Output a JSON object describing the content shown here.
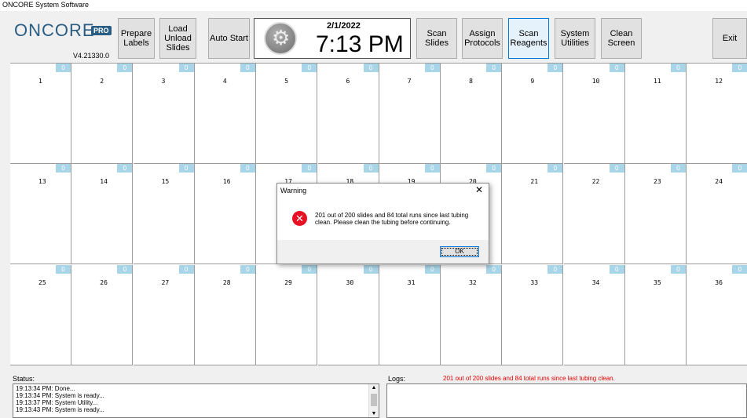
{
  "window": {
    "title": "ONCORE System Software"
  },
  "logo": {
    "word": "ONCORE",
    "badge": "PRO",
    "version": "V4.21330.0"
  },
  "toolbar": {
    "prepare_labels": "Prepare\nLabels",
    "load_unload": "Load\nUnload\nSlides",
    "auto_start": "Auto Start",
    "scan_slides": "Scan\nSlides",
    "assign_protocols": "Assign\nProtocols",
    "scan_reagents": "Scan\nReagents",
    "system_utilities": "System\nUtilities",
    "clean_screen": "Clean\nScreen",
    "exit": "Exit"
  },
  "clock": {
    "date": "2/1/2022",
    "time": "7:13 PM"
  },
  "slots": [
    {
      "num": "1",
      "count": "0"
    },
    {
      "num": "2",
      "count": "0"
    },
    {
      "num": "3",
      "count": "0"
    },
    {
      "num": "4",
      "count": "0"
    },
    {
      "num": "5",
      "count": "0"
    },
    {
      "num": "6",
      "count": "0"
    },
    {
      "num": "7",
      "count": "0"
    },
    {
      "num": "8",
      "count": "0"
    },
    {
      "num": "9",
      "count": "0"
    },
    {
      "num": "10",
      "count": "0"
    },
    {
      "num": "11",
      "count": "0"
    },
    {
      "num": "12",
      "count": "0"
    },
    {
      "num": "13",
      "count": "0"
    },
    {
      "num": "14",
      "count": "0"
    },
    {
      "num": "15",
      "count": "0"
    },
    {
      "num": "16",
      "count": "0"
    },
    {
      "num": "17",
      "count": "0"
    },
    {
      "num": "18",
      "count": "0"
    },
    {
      "num": "19",
      "count": "0"
    },
    {
      "num": "20",
      "count": "0"
    },
    {
      "num": "21",
      "count": "0"
    },
    {
      "num": "22",
      "count": "0"
    },
    {
      "num": "23",
      "count": "0"
    },
    {
      "num": "24",
      "count": "0"
    },
    {
      "num": "25",
      "count": "0"
    },
    {
      "num": "26",
      "count": "0"
    },
    {
      "num": "27",
      "count": "0"
    },
    {
      "num": "28",
      "count": "0"
    },
    {
      "num": "29",
      "count": "0"
    },
    {
      "num": "30",
      "count": "0"
    },
    {
      "num": "31",
      "count": "0"
    },
    {
      "num": "32",
      "count": "0"
    },
    {
      "num": "33",
      "count": "0"
    },
    {
      "num": "34",
      "count": "0"
    },
    {
      "num": "35",
      "count": "0"
    },
    {
      "num": "36",
      "count": "0"
    }
  ],
  "status": {
    "label": "Status:",
    "lines": [
      "19:13:34 PM: Done...",
      "19:13:34 PM: System is ready...",
      "19:13:37 PM: System Utility...",
      "19:13:43 PM: System is ready..."
    ]
  },
  "logs": {
    "label": "Logs:",
    "message": "201 out of 200 slides and  84  total runs since last tubing clean."
  },
  "dialog": {
    "title": "Warning",
    "message": "201 out of 200 slides and  84  total runs since last tubing clean. Please clean the tubing before continuing.",
    "ok": "OK"
  },
  "colors": {
    "badge": "#a9d5e8",
    "brand": "#2a5d83",
    "error": "#e81123",
    "log_text": "#e00000"
  }
}
